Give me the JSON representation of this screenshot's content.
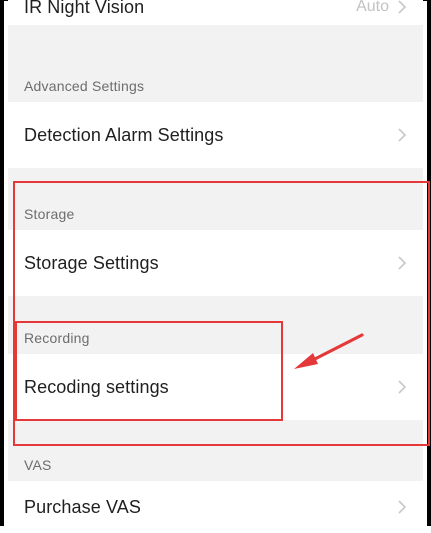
{
  "settings": {
    "items": [
      {
        "type": "item",
        "label": "IR Night Vision",
        "value": "Auto"
      },
      {
        "type": "section",
        "label": "Advanced Settings"
      },
      {
        "type": "item",
        "label": "Detection Alarm Settings"
      },
      {
        "type": "section",
        "label": "Storage"
      },
      {
        "type": "item",
        "label": "Storage Settings"
      },
      {
        "type": "section",
        "label": "Recording"
      },
      {
        "type": "item",
        "label": "Recoding settings"
      },
      {
        "type": "section",
        "label": "VAS"
      },
      {
        "type": "item",
        "label": "Purchase VAS"
      }
    ]
  },
  "icons": {
    "chevron": "chevron-right-icon",
    "arrow": "red-annotation-arrow"
  },
  "colors": {
    "annotation_red": "#e5383b",
    "section_bg": "#f2f2f2",
    "item_bg": "#ffffff",
    "chevron": "#c8c8c8"
  }
}
